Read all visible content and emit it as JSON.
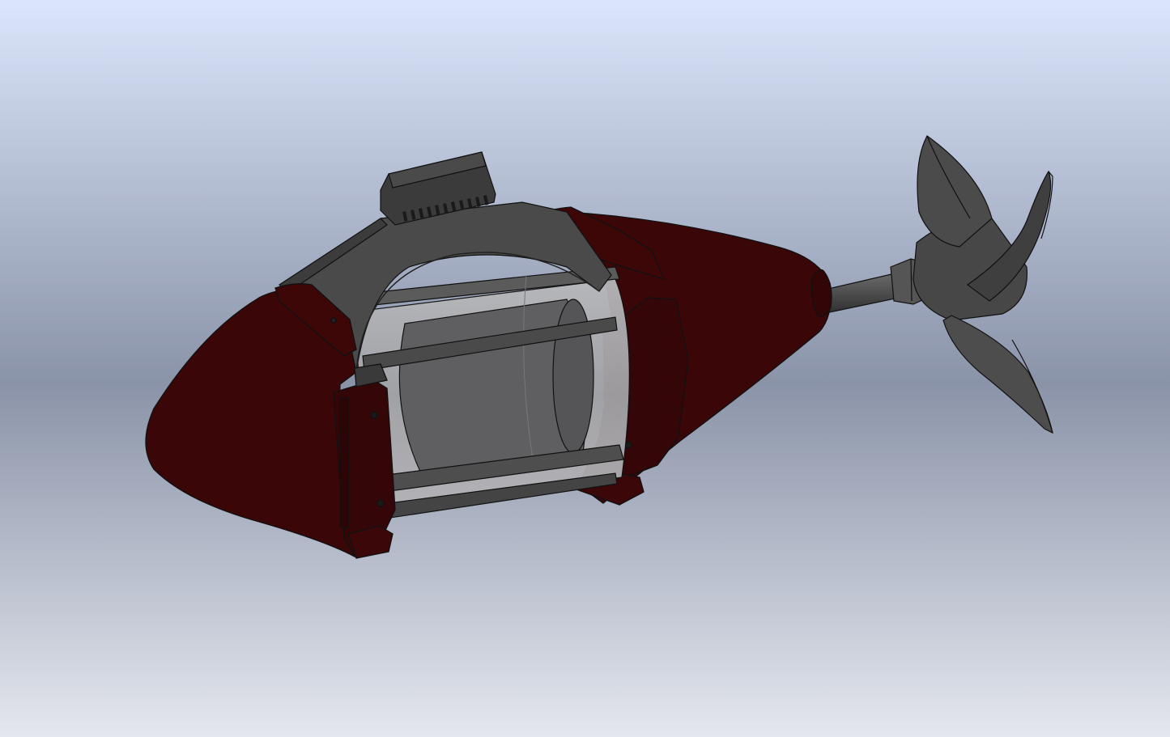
{
  "scene": {
    "description_free": true,
    "background": {
      "top": "#dbe5fb",
      "middle": "#8a93a8",
      "bottom": "#e4e7ee"
    },
    "colors": {
      "shell_red": "#3a0607",
      "shell_red_dark": "#2a0405",
      "frame_gray": "#4a4a4a",
      "frame_dark": "#333333",
      "tube_glass": "#a9a9ad",
      "tube_inner": "#5e5e60",
      "propeller": "#454545",
      "outline": "#111111"
    },
    "parts": [
      {
        "id": "nose-cone",
        "label": ""
      },
      {
        "id": "tail-cone",
        "label": ""
      },
      {
        "id": "electronics-tube",
        "label": ""
      },
      {
        "id": "saddle-bracket",
        "label": ""
      },
      {
        "id": "connector-block",
        "label": ""
      },
      {
        "id": "drive-shaft",
        "label": ""
      },
      {
        "id": "propeller",
        "label": ""
      }
    ]
  }
}
